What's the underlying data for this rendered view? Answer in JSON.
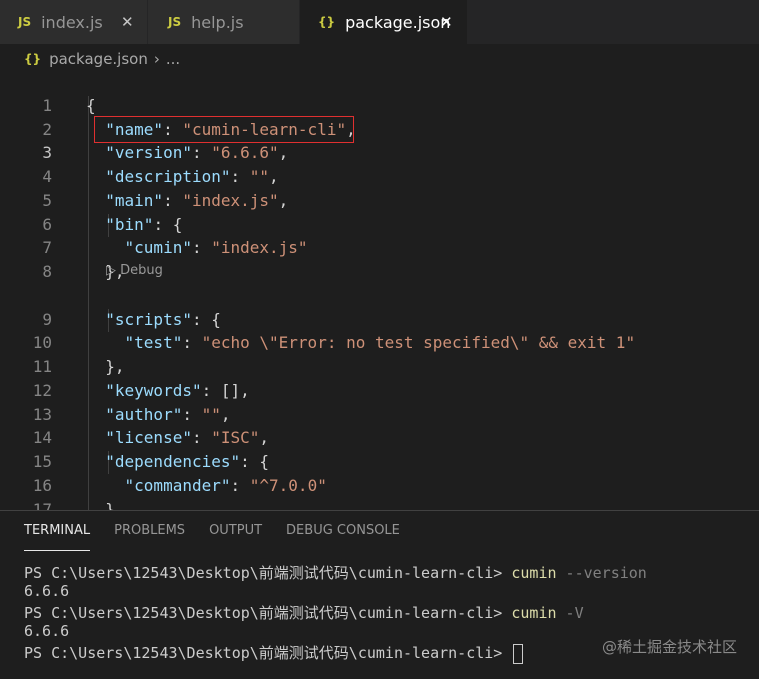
{
  "tabs": [
    {
      "icon": "JS",
      "label": "index.js",
      "active": false,
      "close": "✕"
    },
    {
      "icon": "JS",
      "label": "help.js",
      "active": false
    },
    {
      "icon": "{}",
      "label": "package.json",
      "active": true,
      "close": "✕"
    }
  ],
  "breadcrumb": {
    "icon": "{}",
    "file": "package.json",
    "separator": "›",
    "more": "..."
  },
  "editor": {
    "line_numbers": [
      "1",
      "2",
      "3",
      "4",
      "5",
      "6",
      "7",
      "8",
      "9",
      "10",
      "11",
      "12",
      "13",
      "14",
      "15",
      "16",
      "17"
    ],
    "codelens": "▷ Debug",
    "highlighted_line": "3"
  },
  "panel": {
    "tabs": [
      "TERMINAL",
      "PROBLEMS",
      "OUTPUT",
      "DEBUG CONSOLE"
    ],
    "prompt": "PS C:\\Users\\12543\\Desktop\\前端测试代码\\cumin-learn-cli> ",
    "command": "cumin",
    "arg1": " --version",
    "arg2": " -V",
    "output": "6.6.6"
  },
  "watermark": "@稀土掘金技术社区",
  "colors": {
    "key": "#9cdcfe",
    "string": "#ce9178",
    "highlight_box": "#e03030",
    "command": "#dcdcaa"
  }
}
